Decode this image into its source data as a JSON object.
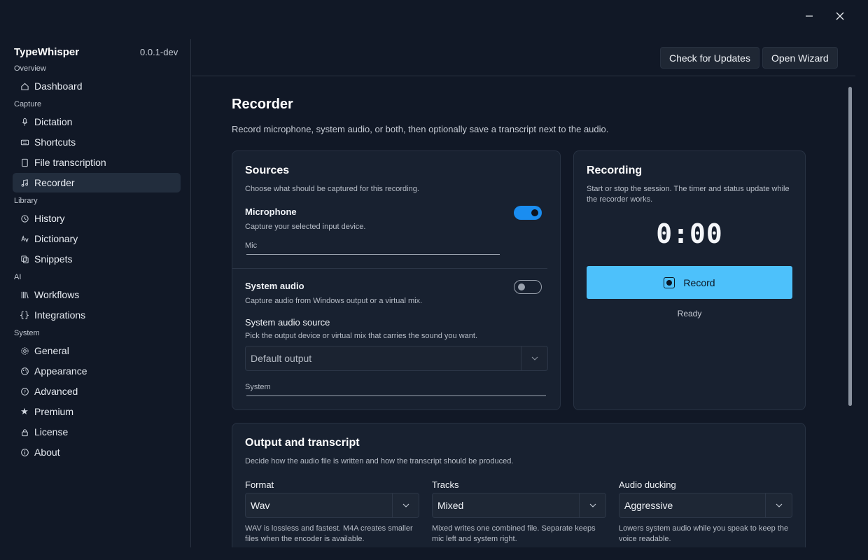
{
  "app": {
    "name": "TypeWhisper",
    "version": "0.0.1-dev"
  },
  "window_controls": {
    "minimize_icon": "minimize-icon",
    "close_icon": "close-icon"
  },
  "sidebar": {
    "sections": [
      {
        "label": "Overview"
      },
      {
        "label": "Capture"
      },
      {
        "label": "Library"
      },
      {
        "label": "AI"
      },
      {
        "label": "System"
      }
    ],
    "items": [
      {
        "label": "Dashboard",
        "icon": "home-icon"
      },
      {
        "label": "Dictation",
        "icon": "microphone-icon"
      },
      {
        "label": "Shortcuts",
        "icon": "keyboard-icon"
      },
      {
        "label": "File transcription",
        "icon": "document-icon"
      },
      {
        "label": "Recorder",
        "icon": "music-note-icon",
        "active": true
      },
      {
        "label": "History",
        "icon": "history-icon"
      },
      {
        "label": "Dictionary",
        "icon": "language-icon"
      },
      {
        "label": "Snippets",
        "icon": "copy-icon"
      },
      {
        "label": "Workflows",
        "icon": "library-icon"
      },
      {
        "label": "Integrations",
        "icon": "braces-icon"
      },
      {
        "label": "General",
        "icon": "gear-icon"
      },
      {
        "label": "Appearance",
        "icon": "palette-icon"
      },
      {
        "label": "Advanced",
        "icon": "help-circle-icon"
      },
      {
        "label": "Premium",
        "icon": "star-icon"
      },
      {
        "label": "License",
        "icon": "lock-icon"
      },
      {
        "label": "About",
        "icon": "info-icon"
      }
    ]
  },
  "header": {
    "check_updates_label": "Check for Updates",
    "open_wizard_label": "Open Wizard"
  },
  "page": {
    "title": "Recorder",
    "description": "Record microphone, system audio, or both, then optionally save a transcript next to the audio."
  },
  "sources": {
    "title": "Sources",
    "subtitle": "Choose what should be captured for this recording.",
    "microphone": {
      "label": "Microphone",
      "description": "Capture your selected input device.",
      "enabled": true,
      "field_label": "Mic"
    },
    "system_audio": {
      "label": "System audio",
      "description": "Capture audio from Windows output or a virtual mix.",
      "enabled": false
    },
    "system_audio_source": {
      "label": "System audio source",
      "description": "Pick the output device or virtual mix that carries the sound you want.",
      "selected": "Default output",
      "field_label": "System"
    }
  },
  "recording": {
    "title": "Recording",
    "subtitle": "Start or stop the session. The timer and status update while the recorder works.",
    "timer": "0:00",
    "record_label": "Record",
    "status": "Ready"
  },
  "output": {
    "title": "Output and transcript",
    "subtitle": "Decide how the audio file is written and how the transcript should be produced.",
    "format": {
      "label": "Format",
      "selected": "Wav",
      "help": "WAV is lossless and fastest. M4A creates smaller files when the encoder is available."
    },
    "tracks": {
      "label": "Tracks",
      "selected": "Mixed",
      "help": "Mixed writes one combined file. Separate keeps mic left and system right."
    },
    "ducking": {
      "label": "Audio ducking",
      "selected": "Aggressive",
      "help": "Lowers system audio while you speak to keep the voice readable."
    }
  },
  "colors": {
    "background": "#111826",
    "card": "#182130",
    "accent": "#1a8df0",
    "record_button": "#4dc1fb"
  }
}
